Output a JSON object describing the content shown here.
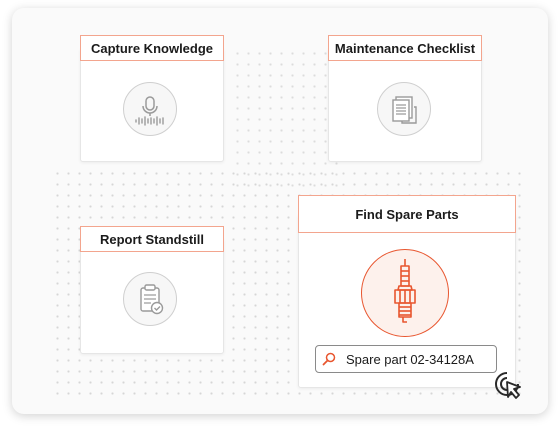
{
  "cards": {
    "capture": {
      "label": "Capture Knowledge",
      "icon": "microphone-waveform-icon"
    },
    "maintenance": {
      "label": "Maintenance Checklist",
      "icon": "documents-icon"
    },
    "report": {
      "label": "Report Standstill",
      "icon": "clipboard-check-icon"
    },
    "spare": {
      "label": "Find Spare Parts",
      "icon": "spark-plug-icon",
      "search_result": "Spare part 02-34128A"
    }
  },
  "colors": {
    "accent": "#e8562f",
    "accent_light": "#fdf1ec",
    "label_border": "#f3a58e",
    "icon_gray": "#9a9a9a"
  }
}
